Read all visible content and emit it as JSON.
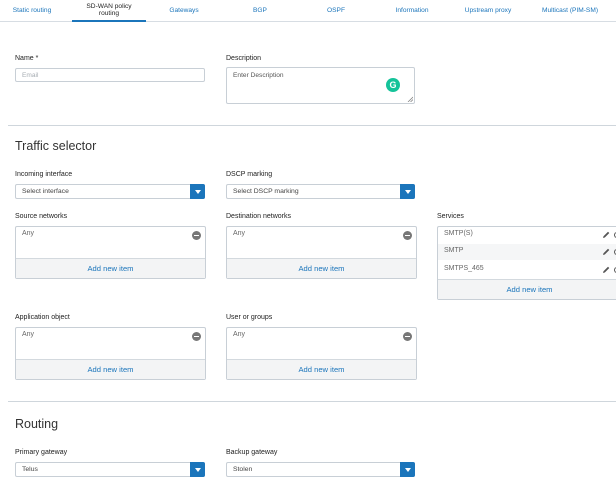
{
  "tabs": [
    {
      "label": "Static routing"
    },
    {
      "label": "SD-WAN policy routing",
      "active": true
    },
    {
      "label": "Gateways"
    },
    {
      "label": "BGP"
    },
    {
      "label": "OSPF"
    },
    {
      "label": "Information"
    },
    {
      "label": "Upstream proxy"
    },
    {
      "label": "Multicast (PIM-SM)"
    }
  ],
  "form": {
    "name_label": "Name *",
    "name_placeholder": "Email",
    "description_label": "Description",
    "description_placeholder": "Enter Description",
    "grammarly_glyph": "G"
  },
  "traffic_selector": {
    "title": "Traffic selector",
    "incoming_interface": {
      "label": "Incoming interface",
      "value": "Select interface"
    },
    "dscp_marking": {
      "label": "DSCP marking",
      "value": "Select DSCP marking"
    },
    "source_networks": {
      "label": "Source networks",
      "items": [
        "Any"
      ],
      "add_label": "Add new item"
    },
    "destination_networks": {
      "label": "Destination networks",
      "items": [
        "Any"
      ],
      "add_label": "Add new item"
    },
    "services": {
      "label": "Services",
      "items": [
        "SMTP(S)",
        "SMTP",
        "SMTPS_465"
      ],
      "add_label": "Add new item"
    },
    "application_object": {
      "label": "Application object",
      "items": [
        "Any"
      ],
      "add_label": "Add new item"
    },
    "user_or_groups": {
      "label": "User or groups",
      "items": [
        "Any"
      ],
      "add_label": "Add new item"
    }
  },
  "routing": {
    "title": "Routing",
    "primary_gateway": {
      "label": "Primary gateway",
      "value": "Telus"
    },
    "backup_gateway": {
      "label": "Backup gateway",
      "value": "Stolen"
    }
  },
  "colors": {
    "accent": "#1b75bb",
    "grammarly": "#15c39a"
  }
}
